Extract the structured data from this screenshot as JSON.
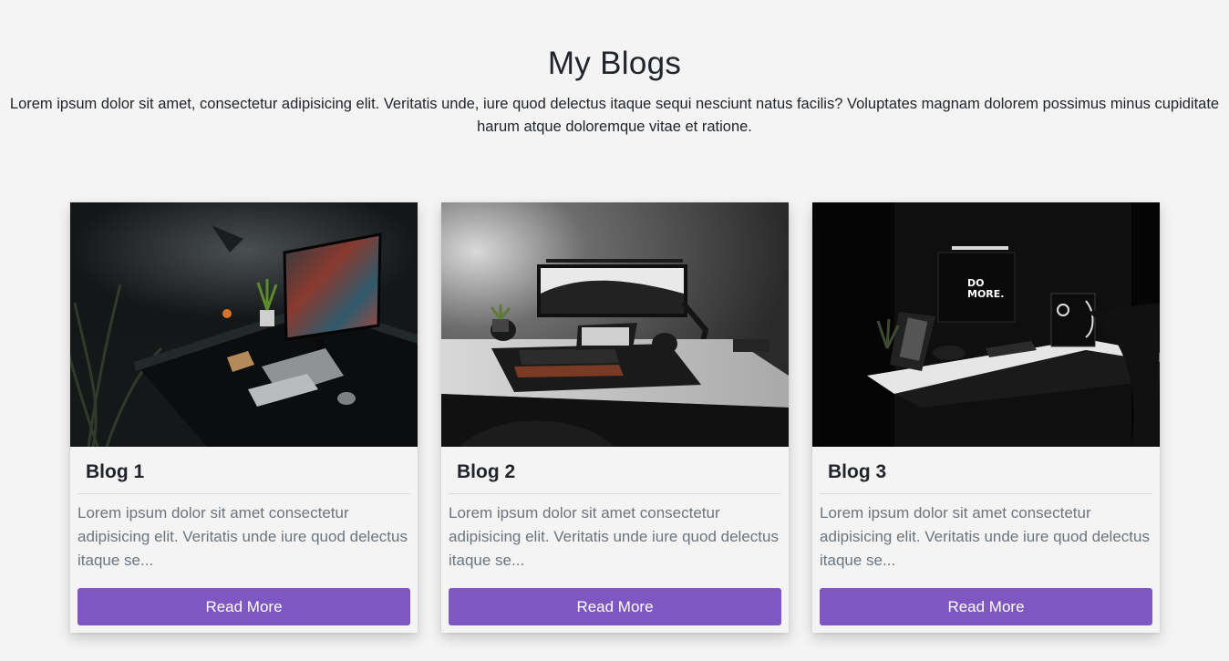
{
  "header": {
    "title": "My Blogs",
    "subtitle": "Lorem ipsum dolor sit amet, consectetur adipisicing elit. Veritatis unde, iure quod delectus itaque sequi nesciunt natus facilis? Voluptates magnam dolorem possimus minus cupiditate harum atque doloremque vitae et ratione."
  },
  "blogs": [
    {
      "title": "Blog 1",
      "excerpt": "Lorem ipsum dolor sit amet consectetur adipisicing elit. Veritatis unde iure quod delectus itaque se...",
      "button_label": "Read More"
    },
    {
      "title": "Blog 2",
      "excerpt": "Lorem ipsum dolor sit amet consectetur adipisicing elit. Veritatis unde iure quod delectus itaque se...",
      "button_label": "Read More"
    },
    {
      "title": "Blog 3",
      "excerpt": "Lorem ipsum dolor sit amet consectetur adipisicing elit. Veritatis unde iure quod delectus itaque se...",
      "button_label": "Read More"
    }
  ],
  "colors": {
    "accent": "#7e57c2",
    "background": "#f4f4f4",
    "muted_text": "#6c757d"
  },
  "screen_text": {
    "do_more": "DO MORE."
  }
}
